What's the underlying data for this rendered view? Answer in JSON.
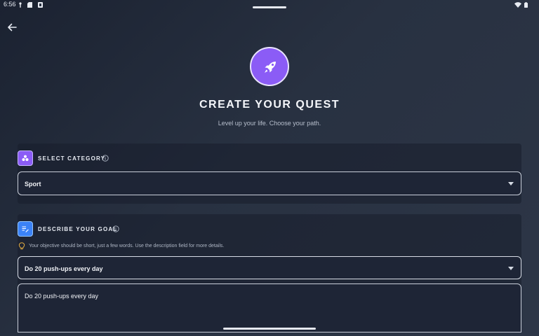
{
  "status_bar": {
    "time": "6:56",
    "left_icons": [
      "tap-icon",
      "sd-card-icon",
      "notification-icon"
    ],
    "right_icons": [
      "wifi-icon",
      "battery-icon"
    ]
  },
  "nav": {
    "back_icon": "arrow-left-icon"
  },
  "header": {
    "badge_icon": "rocket-icon",
    "title": "CREATE YOUR QUEST",
    "subtitle": "Level up your life. Choose your path."
  },
  "category": {
    "label": "SELECT CATEGORY",
    "icon": "category-shapes-icon",
    "selected": "Sport"
  },
  "goal": {
    "label": "DESCRIBE YOUR GOAL",
    "icon": "edit-notes-icon",
    "hint": "Your objective should be short, just a few words. Use the description field for more details.",
    "selected": "Do 20 push-ups every day",
    "description": "Do 20 push-ups every day"
  },
  "colors": {
    "accent_purple": "#8b5cf6",
    "accent_blue": "#3b82f6",
    "hint_yellow": "#f5b942",
    "background": "#283141"
  }
}
